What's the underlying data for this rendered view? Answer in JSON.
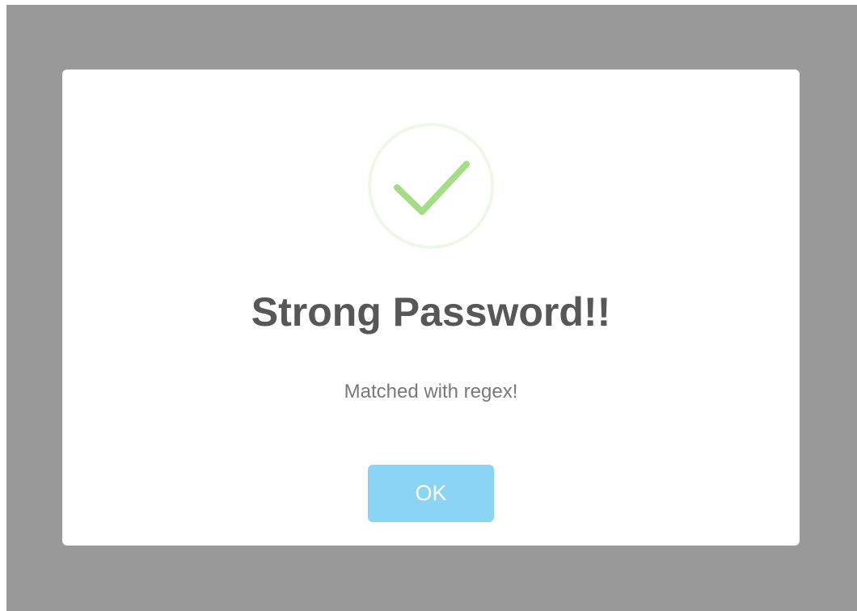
{
  "dialog": {
    "title": "Strong Password!!",
    "text": "Matched with regex!",
    "confirm_label": "OK",
    "icon": "success-check-icon"
  },
  "colors": {
    "overlay": "#999999",
    "dialog_background": "#ffffff",
    "title": "#575757",
    "text": "#797979",
    "button": "#8cd4f5",
    "check": "#a5dc86",
    "check_ring": "#eef8e8"
  }
}
